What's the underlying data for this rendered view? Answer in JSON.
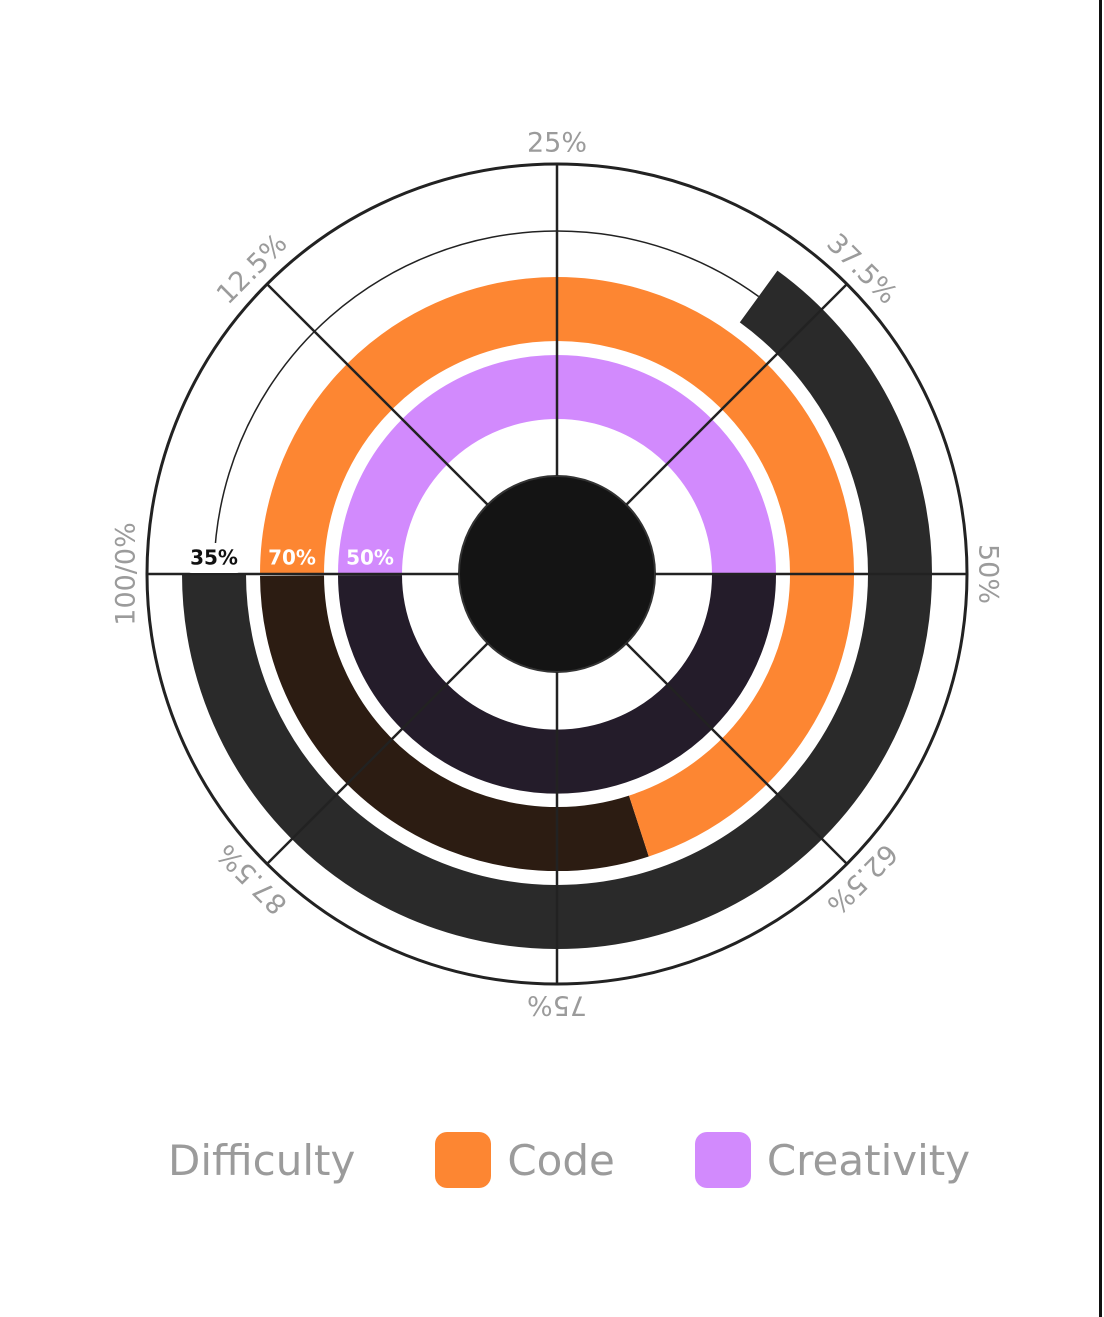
{
  "chart_data": {
    "type": "radial_bar",
    "axis_labels": [
      "25%",
      "37.5%",
      "50%",
      "62.5%",
      "75%",
      "87.5%",
      "100/0%",
      "12.5%"
    ],
    "series": [
      {
        "name": "Difficulty",
        "value": 35,
        "label": "35%",
        "color": "#2a2a2a",
        "label_bg": "#ffffff",
        "label_color": "#111111",
        "show_swatch": false
      },
      {
        "name": "Code",
        "value": 70,
        "label": "70%",
        "color": "#fd8632",
        "track_color": "#2c1c12",
        "label_color": "#ffffff",
        "show_swatch": true
      },
      {
        "name": "Creativity",
        "value": 50,
        "label": "50%",
        "color": "#d28afd",
        "track_color": "#241c2a",
        "label_color": "#ffffff",
        "show_swatch": true
      }
    ],
    "center_color": "#141414",
    "grid_color": "#222222"
  },
  "legend": {
    "items": [
      {
        "label": "Difficulty",
        "icon": "none",
        "color": ""
      },
      {
        "label": "Code",
        "icon": "square-swatch",
        "color": "#fd8632"
      },
      {
        "label": "Creativity",
        "icon": "square-swatch",
        "color": "#d28afd"
      }
    ]
  }
}
